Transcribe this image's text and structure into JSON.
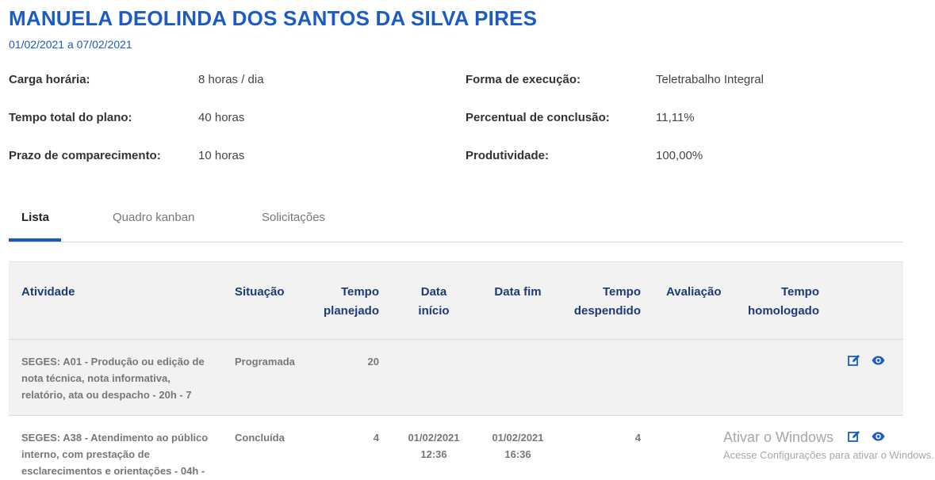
{
  "header": {
    "name": "MANUELA DEOLINDA DOS SANTOS DA SILVA PIRES",
    "period": "01/02/2021 a 07/02/2021"
  },
  "info": {
    "carga_label": "Carga horária:",
    "carga_value": "8 horas / dia",
    "tempo_label": "Tempo total do plano:",
    "tempo_value": "40 horas",
    "prazo_label": "Prazo de comparecimento:",
    "prazo_value": "10 horas",
    "forma_label": "Forma de execução:",
    "forma_value": "Teletrabalho Integral",
    "percentual_label": "Percentual de conclusão:",
    "percentual_value": "11,11%",
    "produtividade_label": "Produtividade:",
    "produtividade_value": "100,00%"
  },
  "tabs": [
    {
      "label": "Lista",
      "active": true
    },
    {
      "label": "Quadro kanban",
      "active": false
    },
    {
      "label": "Solicitações",
      "active": false
    }
  ],
  "table": {
    "headers": {
      "atividade": "Atividade",
      "situacao": "Situação",
      "tempo_planejado_1": "Tempo",
      "tempo_planejado_2": "planejado",
      "data_inicio_1": "Data",
      "data_inicio_2": "início",
      "data_fim": "Data fim",
      "tempo_despendido_1": "Tempo",
      "tempo_despendido_2": "despendido",
      "avaliacao": "Avaliação",
      "tempo_homologado_1": "Tempo",
      "tempo_homologado_2": "homologado"
    },
    "rows": [
      {
        "atividade_1": "SEGES: A01 - Produção ou edição de",
        "atividade_2": "nota técnica, nota informativa,",
        "atividade_3": "relatório, ata ou despacho - 20h - 7",
        "situacao": "Programada",
        "tempo_planejado": "20",
        "data_inicio_date": "",
        "data_inicio_time": "",
        "data_fim_date": "",
        "data_fim_time": "",
        "tempo_despendido": "",
        "avaliacao": "",
        "tempo_homologado": ""
      },
      {
        "atividade_1": "SEGES: A38 - Atendimento ao público",
        "atividade_2": "interno, com prestação de",
        "atividade_3": "esclarecimentos e orientações - 04h -",
        "situacao": "Concluída",
        "tempo_planejado": "4",
        "data_inicio_date": "01/02/2021",
        "data_inicio_time": "12:36",
        "data_fim_date": "01/02/2021",
        "data_fim_time": "16:36",
        "tempo_despendido": "4",
        "avaliacao": "",
        "tempo_homologado": ""
      }
    ]
  },
  "watermark": {
    "title": "Ativar o Windows",
    "subtitle": "Acesse Configurações para ativar o Windows."
  },
  "colors": {
    "accent": "#1b5cc4",
    "header_text": "#1e3a78",
    "row_alt": "#f2f2f2"
  },
  "icons": {
    "edit": "edit-icon",
    "view": "eye-icon"
  }
}
